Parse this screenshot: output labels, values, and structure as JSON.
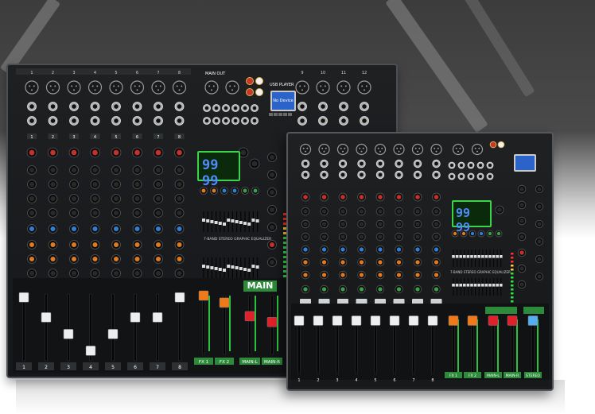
{
  "big_mixer": {
    "channel_numbers": [
      "1",
      "2",
      "3",
      "4",
      "5",
      "6",
      "7",
      "8",
      "9",
      "10",
      "11",
      "12"
    ],
    "fader_numbers": [
      "1",
      "2",
      "3",
      "4",
      "5",
      "6",
      "7",
      "8"
    ],
    "main_out_label": "MAIN OUT",
    "usb_player_label": "USB PLAYER",
    "usb_screen_text": "No Device",
    "fx_display": "99 99",
    "eq_caption": "7-BAND STEREO GRAPHIC EQUALIZER",
    "main_label": "MAIN",
    "fader_labels": [
      "FX 1",
      "FX 2",
      "MAIN-L",
      "MAIN-R"
    ]
  },
  "small_mixer": {
    "fader_numbers": [
      "1",
      "2",
      "3",
      "4",
      "5",
      "6",
      "7",
      "8"
    ],
    "fx_display": "99 99",
    "eq_caption": "7-BAND STEREO GRAPHIC EQUALIZER",
    "fader_labels": [
      "FX 1",
      "FX 2",
      "MAIN-L",
      "MAIN-R",
      "STEREO"
    ]
  },
  "colors": {
    "knob_red": "#c9302c",
    "knob_green": "#3aa04a",
    "knob_blue": "#2f7fd6",
    "knob_orange": "#e07a1f",
    "knob_yellow": "#d8b62b",
    "fader_white": "#eeeeee",
    "fader_orange": "#f07a1a",
    "fader_red": "#e0202a",
    "fader_blue": "#55aef0",
    "accent_green": "#2cc23f"
  }
}
